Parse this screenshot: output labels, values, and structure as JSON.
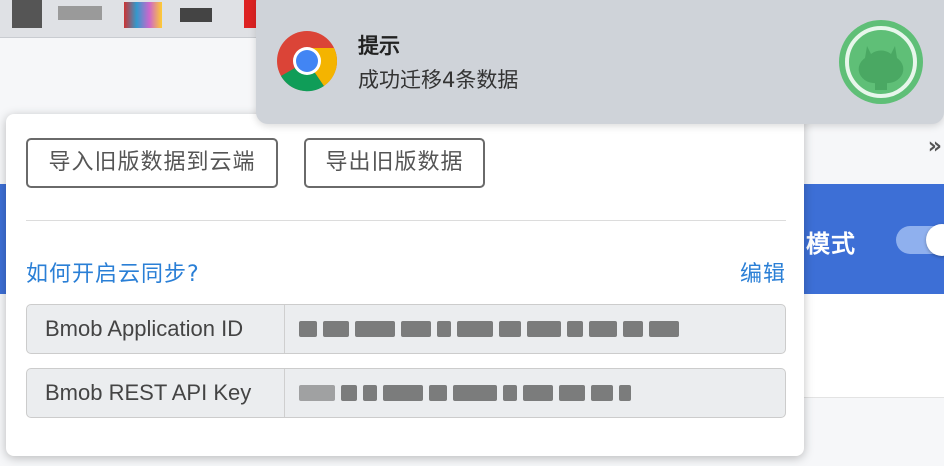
{
  "background": {
    "mode_label": "模式",
    "overflow_chevron": "»",
    "accent_color": "#3d6fd6"
  },
  "popup": {
    "import_button": "导入旧版数据到云端",
    "export_button": "导出旧版数据",
    "help_link": "如何开启云同步?",
    "edit_link": "编辑",
    "fields": {
      "app_id_label": "Bmob Application ID",
      "api_key_label": "Bmob REST API Key"
    }
  },
  "notification": {
    "title": "提示",
    "message": "成功迁移4条数据",
    "app_icon": "chrome-icon",
    "badge_icon": "github-octocat-icon",
    "badge_color": "#5fbf77"
  }
}
